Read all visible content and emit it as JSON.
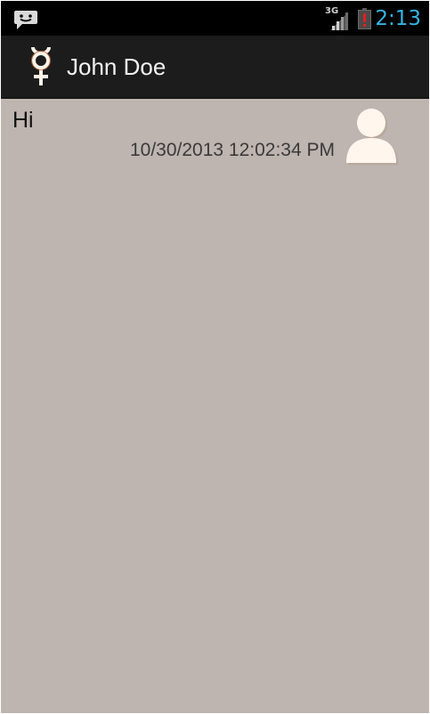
{
  "status_bar": {
    "notification_icon": "chat-bubble-icon",
    "network_label": "3G",
    "signal_icon": "signal-bars-icon",
    "battery_icon": "battery-alert-icon",
    "time": "2:13"
  },
  "action_bar": {
    "app_icon": "mercury-symbol-icon",
    "title": "John Doe"
  },
  "conversation": {
    "messages": [
      {
        "text": "Hi",
        "timestamp": "10/30/2013 12:02:34 PM",
        "avatar_icon": "contact-avatar-icon"
      }
    ]
  },
  "colors": {
    "status_bar_bg": "#000000",
    "action_bar_bg": "#1c1c1c",
    "conversation_bg": "#beb4b0",
    "clock": "#33b5e5",
    "avatar_fill": "#fff6ee"
  }
}
